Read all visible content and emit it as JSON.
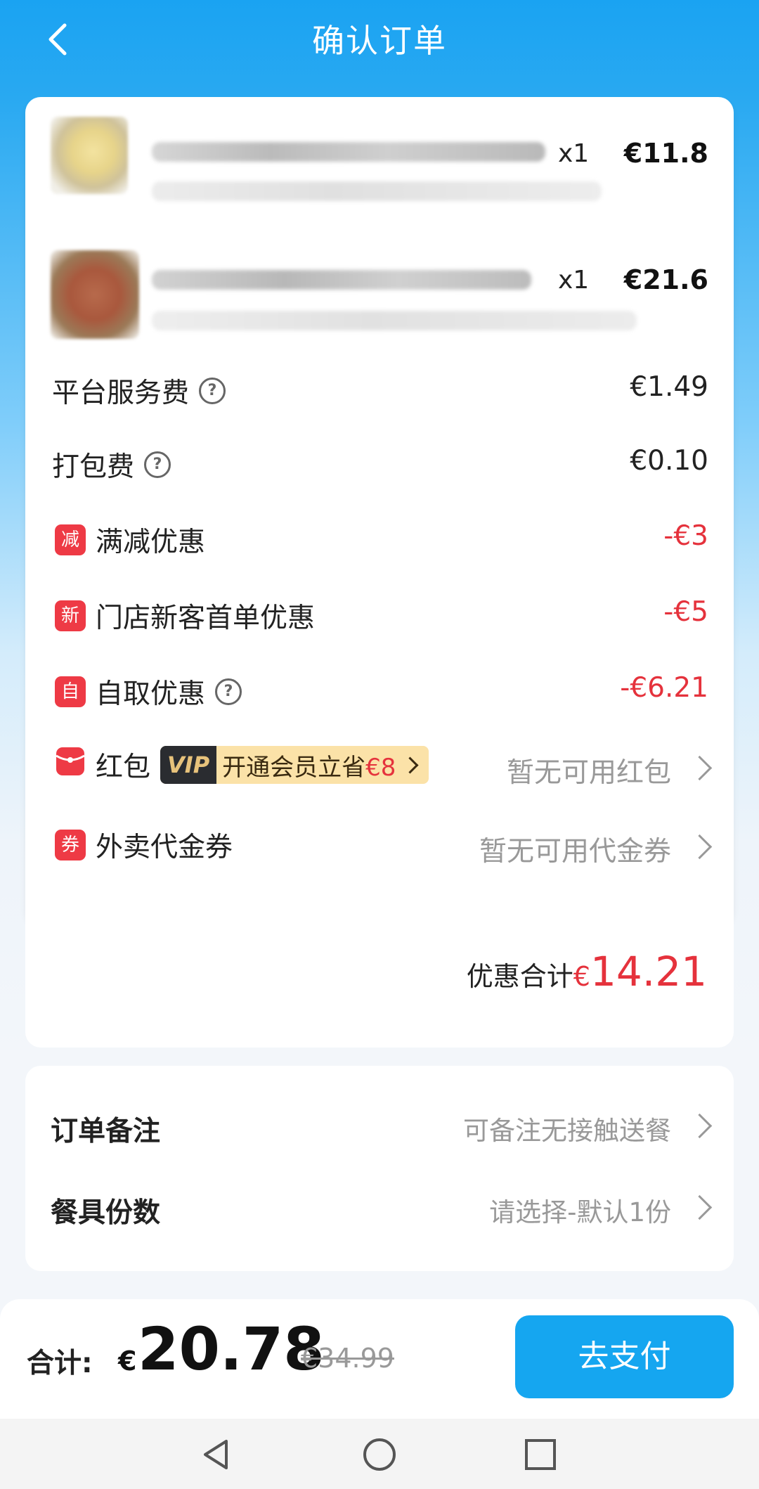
{
  "header": {
    "title": "确认订单",
    "back_icon": "chevron-left-icon"
  },
  "items": [
    {
      "qty": "x1",
      "price": "€11.8"
    },
    {
      "qty": "x1",
      "price": "€21.6"
    }
  ],
  "fees": [
    {
      "label": "平台服务费",
      "value": "€1.49",
      "help": "?"
    },
    {
      "label": "打包费",
      "value": "€0.10",
      "help": "?"
    }
  ],
  "discounts": [
    {
      "icon_text": "减",
      "label": "满减优惠",
      "value": "-€3"
    },
    {
      "icon_text": "新",
      "label": "门店新客首单优惠",
      "value": "-€5"
    },
    {
      "icon_text": "自",
      "label": "自取优惠",
      "value": "-€6.21",
      "help": "?"
    }
  ],
  "redpacket": {
    "label": "红包",
    "vip_tag": "VIP",
    "vip_text": "开通会员立省",
    "vip_amount": "€8",
    "value": "暂无可用红包"
  },
  "voucher": {
    "icon_text": "券",
    "label": "外卖代金券",
    "value": "暂无可用代金券"
  },
  "discount_total": {
    "label": "优惠合计",
    "currency": "€",
    "amount": "14.21"
  },
  "options": [
    {
      "label": "订单备注",
      "value": "可备注无接触送餐"
    },
    {
      "label": "餐具份数",
      "value": "请选择-默认1份"
    }
  ],
  "footer": {
    "total_label": "合计:",
    "currency": "€",
    "total": "20.78",
    "original": "€34.99",
    "pay_label": "去支付"
  },
  "colors": {
    "accent": "#15a6f0",
    "discount": "#e5323c"
  }
}
